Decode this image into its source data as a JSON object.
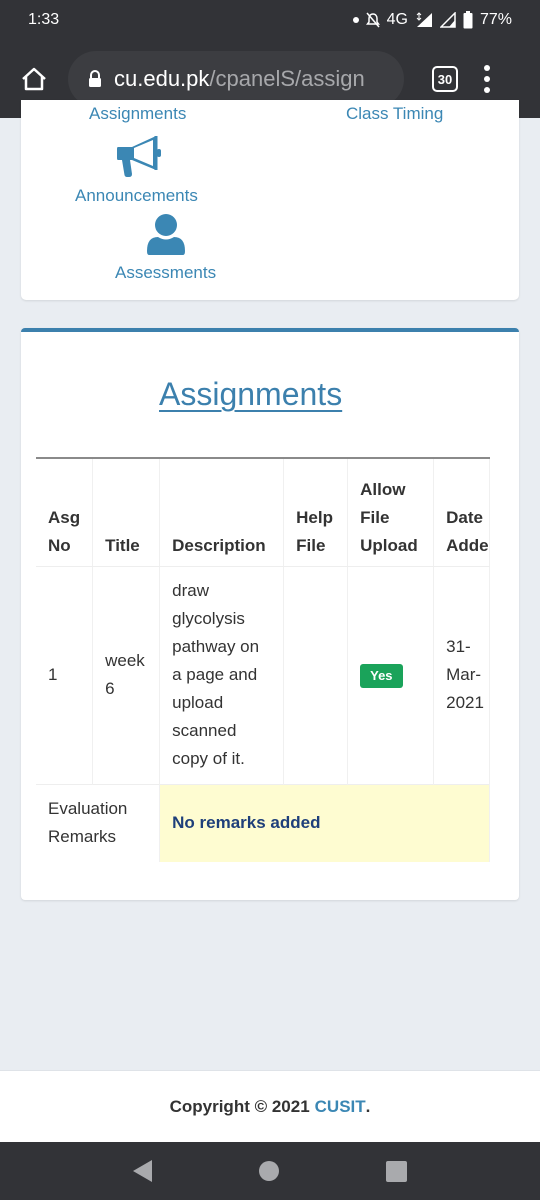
{
  "status_bar": {
    "time": "1:33",
    "network": "4G",
    "battery": "77%"
  },
  "browser": {
    "url_host": "cu.edu.pk",
    "url_path": "/cpanelS/assign",
    "tab_count": "30"
  },
  "quick_links": {
    "assignments": "Assignments",
    "class_timing": "Class Timing",
    "announcements": "Announcements",
    "assessments": "Assessments"
  },
  "main": {
    "title": "Assignments",
    "table": {
      "headers": {
        "asg_no_1": "Asg",
        "asg_no_2": "No",
        "title": "Title",
        "description": "Description",
        "help_file_1": "Help",
        "help_file_2": "File",
        "allow_1": "Allow",
        "allow_2": "File",
        "allow_3": "Upload",
        "date_1": "Date",
        "date_2": "Adde"
      },
      "rows": [
        {
          "asg_no": "1",
          "title": "week 6",
          "description": "draw glycolysis pathway on a page and upload scanned copy of it.",
          "help_file": "",
          "allow_upload": "Yes",
          "date_added_1": "31-",
          "date_added_2": "Mar-",
          "date_added_3": "2021"
        }
      ],
      "remarks_label_1": "Evaluation",
      "remarks_label_2": "Remarks",
      "remarks_value": "No remarks added"
    }
  },
  "footer": {
    "copyright": "Copyright © 2021",
    "brand": "CUSIT",
    "period": "."
  },
  "colors": {
    "accent": "#3c80ad",
    "link": "#3b87b4",
    "badge_green": "#1aa35a",
    "remarks_bg": "#fefcd1",
    "remarks_text": "#1e3f7a"
  }
}
